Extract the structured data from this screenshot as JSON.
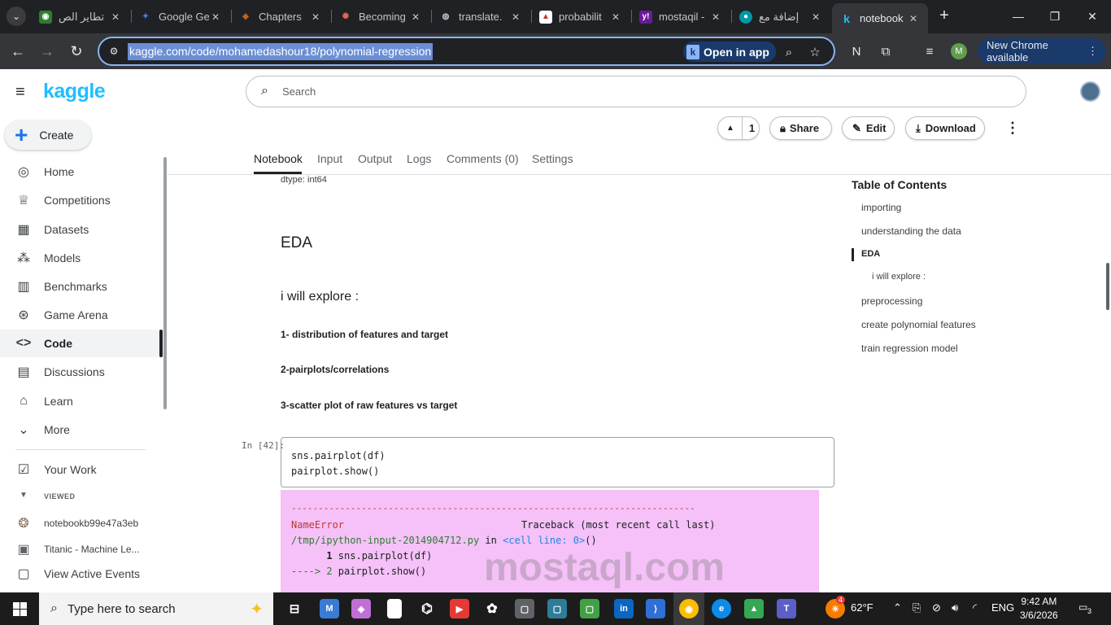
{
  "browser": {
    "tabs": [
      {
        "label": "تطاير الص",
        "favicon_color": "#2e7d32",
        "favicon": "◉"
      },
      {
        "label": "Google Ge",
        "favicon_color": "#4285f4",
        "favicon": "✦"
      },
      {
        "label": "Chapters",
        "favicon_color": "#8d5524",
        "favicon": "◆"
      },
      {
        "label": "Becoming",
        "favicon_color": "#d9534f",
        "favicon": "✺"
      },
      {
        "label": "translate.",
        "favicon_color": "#5f6368",
        "favicon": "◍"
      },
      {
        "label": "probabilit",
        "favicon_color": "#c0392b",
        "favicon": "▲"
      },
      {
        "label": "mostaqil -",
        "favicon_color": "#6a1b9a",
        "favicon": "y!"
      },
      {
        "label": "إضافة مع",
        "favicon_color": "#0097a7",
        "favicon": "●"
      },
      {
        "label": "notebook",
        "favicon_color": "#20beff",
        "favicon": "k"
      }
    ],
    "url": "kaggle.com/code/mohamedashour18/polynomial-regression",
    "open_in_app": "Open in app",
    "profile_letter": "M",
    "new_chrome": "New Chrome available"
  },
  "kaggle": {
    "logo": "kaggle",
    "search_placeholder": "Search",
    "create_label": "Create",
    "nav": [
      {
        "label": "Home",
        "icon": "compass-icon"
      },
      {
        "label": "Competitions",
        "icon": "trophy-icon"
      },
      {
        "label": "Datasets",
        "icon": "table-icon"
      },
      {
        "label": "Models",
        "icon": "models-icon"
      },
      {
        "label": "Benchmarks",
        "icon": "bar-chart-icon"
      },
      {
        "label": "Game Arena",
        "icon": "gamepad-icon"
      },
      {
        "label": "Code",
        "icon": "code-icon"
      },
      {
        "label": "Discussions",
        "icon": "discussions-icon"
      },
      {
        "label": "Learn",
        "icon": "graduation-cap-icon"
      },
      {
        "label": "More",
        "icon": "chevron-down-icon"
      }
    ],
    "your_work": "Your Work",
    "viewed_label": "VIEWED",
    "viewed_items": [
      {
        "label": "notebookb99e47a3eb"
      },
      {
        "label": "Titanic - Machine Le..."
      },
      {
        "label": "View Active Events"
      }
    ],
    "vote_count": "1",
    "share_label": "Share",
    "edit_label": "Edit",
    "download_label": "Download",
    "tabs": [
      "Notebook",
      "Input",
      "Output",
      "Logs",
      "Comments (0)",
      "Settings"
    ],
    "notebook": {
      "dtype_line": "dtype: int64",
      "eda_heading": "EDA",
      "explore_heading": "i will explore :",
      "points": [
        "1- distribution of features and target",
        "2-pairplots/correlations",
        "3-scatter plot of raw features vs target"
      ],
      "in_label": "In [42]:",
      "code": [
        "sns.pairplot(df)",
        "pairplot.show()"
      ],
      "error": {
        "dashes": "---------------------------------------------------------------------------",
        "name": "NameError",
        "traceback": "Traceback (most recent call last)",
        "file": "/tmp/ipython-input-2014904712.py",
        "in_word": " in ",
        "cell_ref": "<cell line: 0>",
        "cell_paren": "()",
        "line1_no": "      1",
        "line1_code": " sns.pairplot(df)",
        "line2_no": "----> 2",
        "line2_code": " pairplot.show()"
      }
    },
    "toc": {
      "title": "Table of Contents",
      "items": [
        {
          "label": "importing",
          "indent": 0
        },
        {
          "label": "understanding the data",
          "indent": 0
        },
        {
          "label": "EDA",
          "indent": 0
        },
        {
          "label": "i will explore :",
          "indent": 1
        },
        {
          "label": "preprocessing",
          "indent": 0
        },
        {
          "label": "create polynomial features",
          "indent": 0
        },
        {
          "label": "train regression model",
          "indent": 0
        }
      ],
      "active": "EDA"
    }
  },
  "taskbar": {
    "search_placeholder": "Type here to search",
    "weather": "62°F",
    "language": "ENG",
    "time": "9:42 AM",
    "date": "3/6/2026",
    "notification_count": "3",
    "weather_badge": "4"
  },
  "watermark": "mostaql.com"
}
